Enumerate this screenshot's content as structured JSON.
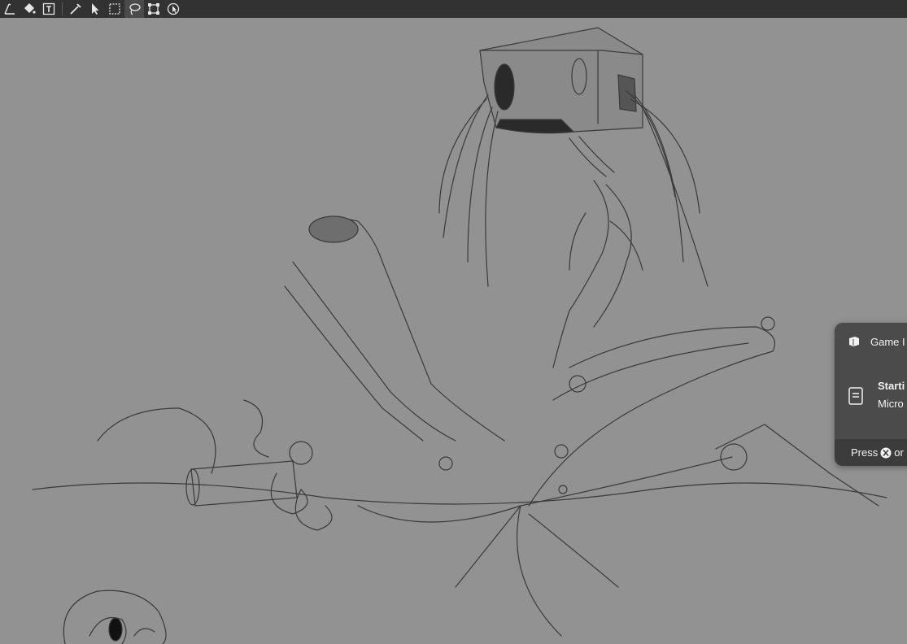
{
  "toolbar": {
    "tools": [
      {
        "icon": "pen-icon"
      },
      {
        "icon": "fill-bucket-icon"
      },
      {
        "icon": "text-tool-icon"
      },
      {
        "icon": "eyedropper-icon"
      },
      {
        "icon": "select-arrow-icon"
      },
      {
        "icon": "rect-select-icon"
      },
      {
        "icon": "lasso-icon",
        "active": true
      },
      {
        "icon": "transform-icon"
      },
      {
        "icon": "move-select-icon"
      }
    ]
  },
  "notification": {
    "header_title": "Game I",
    "status_line1": "Starti",
    "status_line2": "Micro",
    "footer_press": "Press",
    "footer_or": "or"
  },
  "colors": {
    "canvas_bg": "#929292",
    "toolbar_bg": "#323232",
    "toast_bg": "#4b4b4b",
    "toast_footer_bg": "#3c3c3c",
    "sketch_stroke": "#3a3a3a"
  }
}
